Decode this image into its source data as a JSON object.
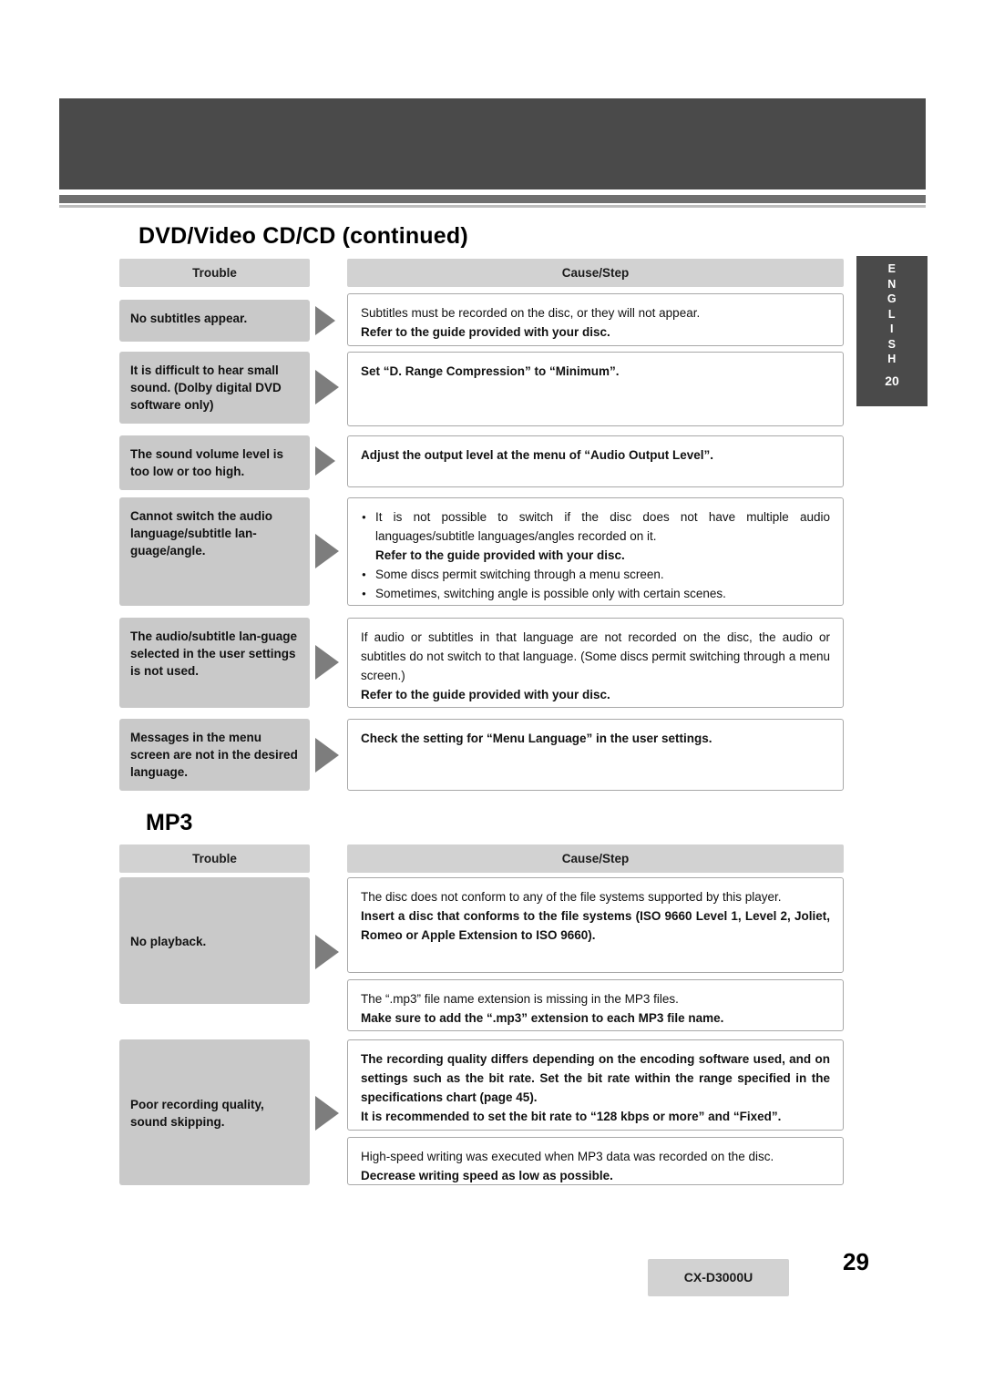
{
  "page": {
    "title": "DVD/Video CD/CD (continued)",
    "mp3_heading": "MP3",
    "side_tab": {
      "letters": [
        "E",
        "N",
        "G",
        "L",
        "I",
        "S",
        "H"
      ],
      "number": "20"
    },
    "footer": {
      "model": "CX-D3000U",
      "page_number": "29"
    }
  },
  "headers": {
    "trouble": "Trouble",
    "cause": "Cause/Step"
  },
  "dvd_rows": [
    {
      "trouble": "No subtitles appear.",
      "lines": [
        {
          "text": "Subtitles must be recorded on the disc, or they will not appear.",
          "bold": false,
          "bullet": false
        },
        {
          "text": "Refer to the guide provided with your disc.",
          "bold": true,
          "bullet": false
        }
      ]
    },
    {
      "trouble": "It is difficult to hear small sound. (Dolby digital DVD software only)",
      "lines": [
        {
          "text": "Set “D. Range Compression” to “Minimum”.",
          "bold": true,
          "bullet": false
        }
      ]
    },
    {
      "trouble": "The sound volume level is too low or too high.",
      "lines": [
        {
          "text": "Adjust the output level at the menu of “Audio Output Level”.",
          "bold": true,
          "bullet": false
        }
      ]
    },
    {
      "trouble": "Cannot switch the audio language/subtitle lan-guage/angle.",
      "lines": [
        {
          "text": "It is not possible to switch if the disc does not have multiple audio languages/subtitle languages/angles recorded on it.",
          "bold": false,
          "bullet": true
        },
        {
          "text": "Refer to the guide provided with your disc.",
          "bold": true,
          "bullet": false
        },
        {
          "text": "Some discs permit switching through a menu screen.",
          "bold": false,
          "bullet": true
        },
        {
          "text": "Sometimes, switching angle is possible only with certain scenes.",
          "bold": false,
          "bullet": true
        }
      ]
    },
    {
      "trouble": "The audio/subtitle lan-guage selected in the user settings is not used.",
      "lines": [
        {
          "text": "If audio or subtitles in that language are not recorded on the disc, the audio or subtitles do not switch to that language. (Some discs permit switching through a menu screen.)",
          "bold": false,
          "bullet": false
        },
        {
          "text": "Refer to the guide provided with your disc.",
          "bold": true,
          "bullet": false
        }
      ]
    },
    {
      "trouble": "Messages in the menu screen are not in the desired language.",
      "lines": [
        {
          "text": "Check the setting for “Menu Language” in the user settings.",
          "bold": true,
          "bullet": false
        }
      ]
    }
  ],
  "mp3_rows": [
    {
      "trouble": "No playback.",
      "blocks": [
        {
          "lines": [
            {
              "text": "The disc does not conform to any of the file systems supported by this player.",
              "bold": false
            },
            {
              "text": "Insert a disc that conforms to the file systems (ISO 9660 Level 1, Level 2, Joliet, Romeo or Apple Extension to ISO 9660).",
              "bold": true
            }
          ]
        },
        {
          "lines": [
            {
              "text": "The “.mp3” file name extension is missing in the MP3 files.",
              "bold": false
            },
            {
              "text": "Make sure to add the “.mp3” extension to each MP3 file name.",
              "bold": true
            }
          ]
        }
      ]
    },
    {
      "trouble": "Poor recording quality, sound skipping.",
      "blocks": [
        {
          "lines": [
            {
              "text": "The recording quality differs depending on the encoding software used, and on settings such as the bit rate. Set the bit rate within the range specified in the specifications chart (page 45).",
              "bold": true
            },
            {
              "text": "It is recommended to set the bit rate to “128 kbps or more” and “Fixed”.",
              "bold": true
            }
          ]
        },
        {
          "lines": [
            {
              "text": "High-speed writing was executed when MP3 data was recorded on the disc.",
              "bold": false
            },
            {
              "text": "Decrease writing speed as low as possible.",
              "bold": true
            }
          ]
        }
      ]
    }
  ]
}
